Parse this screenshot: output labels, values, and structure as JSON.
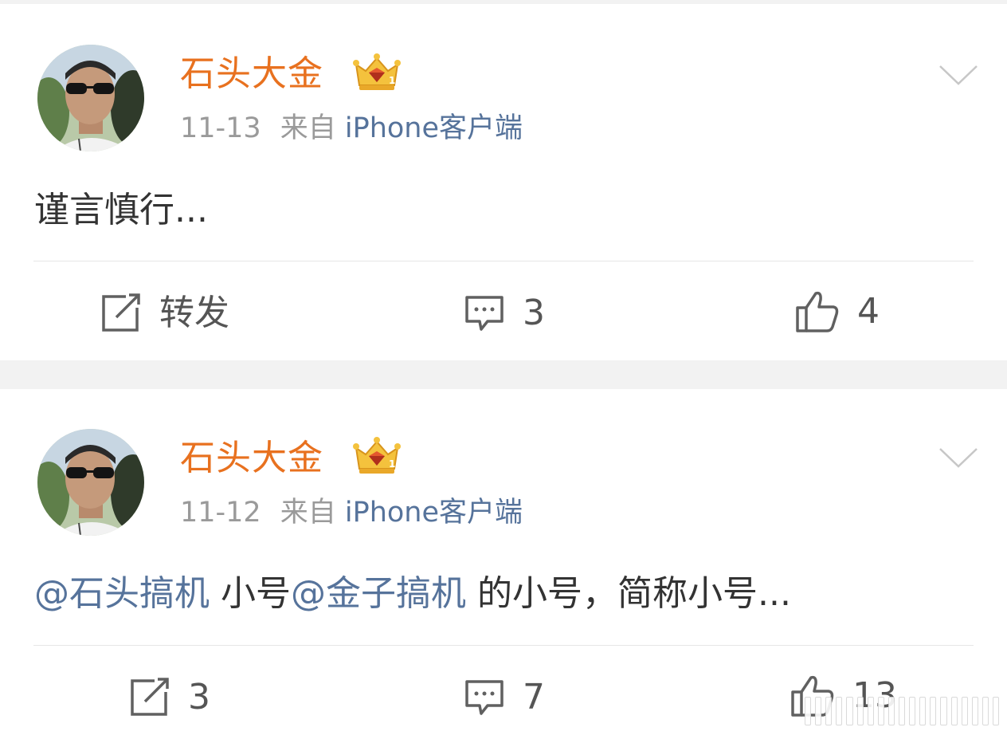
{
  "posts": [
    {
      "username": "石头大金",
      "date": "11-13",
      "source_prefix": "来自",
      "source": "iPhone客户端",
      "text_plain": "谨言慎行...",
      "actions": {
        "repost_label": "转发",
        "comment_count": "3",
        "like_count": "4"
      }
    },
    {
      "username": "石头大金",
      "date": "11-12",
      "source_prefix": "来自",
      "source": "iPhone客户端",
      "text_mention_1": "@石头搞机",
      "text_middle": " 小号",
      "text_mention_2": "@金子搞机",
      "text_end": " 的小号，简称小号...",
      "actions": {
        "repost_label": "3",
        "comment_count": "7",
        "like_count": "13"
      }
    }
  ],
  "colors": {
    "username": "#e8711f",
    "mention": "#56739b",
    "meta": "#9a9a9a",
    "text": "#333333",
    "page_background": "#f2f2f2"
  },
  "icons": {
    "badge": "crown-badge-icon",
    "menu": "chevron-down-icon",
    "repost": "repost-icon",
    "comment": "comment-icon",
    "like": "thumbs-up-icon"
  }
}
